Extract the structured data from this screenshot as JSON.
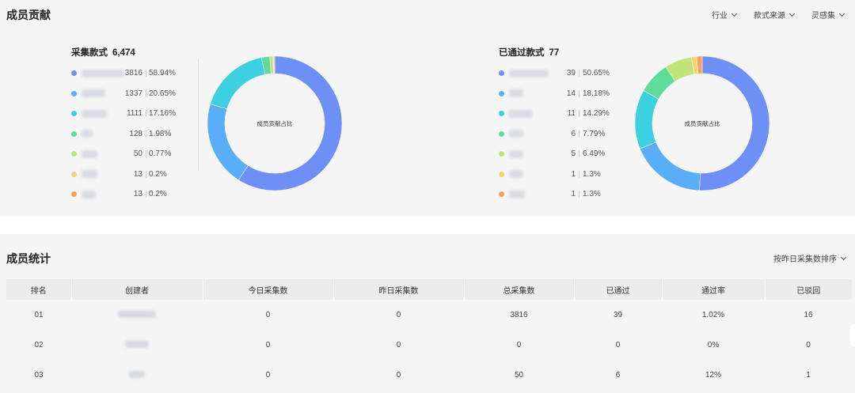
{
  "contribution": {
    "title": "成员贡献",
    "filters": [
      "行业",
      "款式来源",
      "灵感集"
    ],
    "collected": {
      "label": "采集款式",
      "total": "6,474",
      "center_label": "成员贡献占比",
      "items": [
        {
          "color": "#6e8ff5",
          "count": "3816",
          "pct": "58.94%",
          "value": 3816
        },
        {
          "color": "#5aaef7",
          "count": "1337",
          "pct": "20.65%",
          "value": 1337
        },
        {
          "color": "#3dd0e0",
          "count": "1111",
          "pct": "17.16%",
          "value": 1111
        },
        {
          "color": "#5fdb9a",
          "count": "128",
          "pct": "1.98%",
          "value": 128
        },
        {
          "color": "#c2e37a",
          "count": "50",
          "pct": "0.77%",
          "value": 50
        },
        {
          "color": "#f7d36b",
          "count": "13",
          "pct": "0.2%",
          "value": 13
        },
        {
          "color": "#f5a35a",
          "count": "13",
          "pct": "0.2%",
          "value": 13
        }
      ]
    },
    "passed": {
      "label": "已通过款式",
      "total": "77",
      "center_label": "成员贡献占比",
      "items": [
        {
          "color": "#6e8ff5",
          "count": "39",
          "pct": "50.65%",
          "value": 39
        },
        {
          "color": "#5aaef7",
          "count": "14",
          "pct": "18.18%",
          "value": 14
        },
        {
          "color": "#3dd0e0",
          "count": "11",
          "pct": "14.29%",
          "value": 11
        },
        {
          "color": "#5fdb9a",
          "count": "6",
          "pct": "7.79%",
          "value": 6
        },
        {
          "color": "#c2e37a",
          "count": "5",
          "pct": "6.49%",
          "value": 5
        },
        {
          "color": "#f7d36b",
          "count": "1",
          "pct": "1.3%",
          "value": 1
        },
        {
          "color": "#f5a35a",
          "count": "1",
          "pct": "1.3%",
          "value": 1
        }
      ]
    }
  },
  "stats": {
    "title": "成员统计",
    "sort_label": "按昨日采集数排序",
    "columns": [
      "排名",
      "创建者",
      "今日采集数",
      "昨日采集数",
      "总采集数",
      "已通过",
      "通过率",
      "已驳回"
    ],
    "rows": [
      [
        "01",
        "",
        "0",
        "0",
        "3816",
        "39",
        "1.02%",
        "16"
      ],
      [
        "02",
        "",
        "0",
        "0",
        "0",
        "0",
        "0%",
        "0"
      ],
      [
        "03",
        "",
        "0",
        "0",
        "50",
        "6",
        "12%",
        "1"
      ]
    ]
  }
}
